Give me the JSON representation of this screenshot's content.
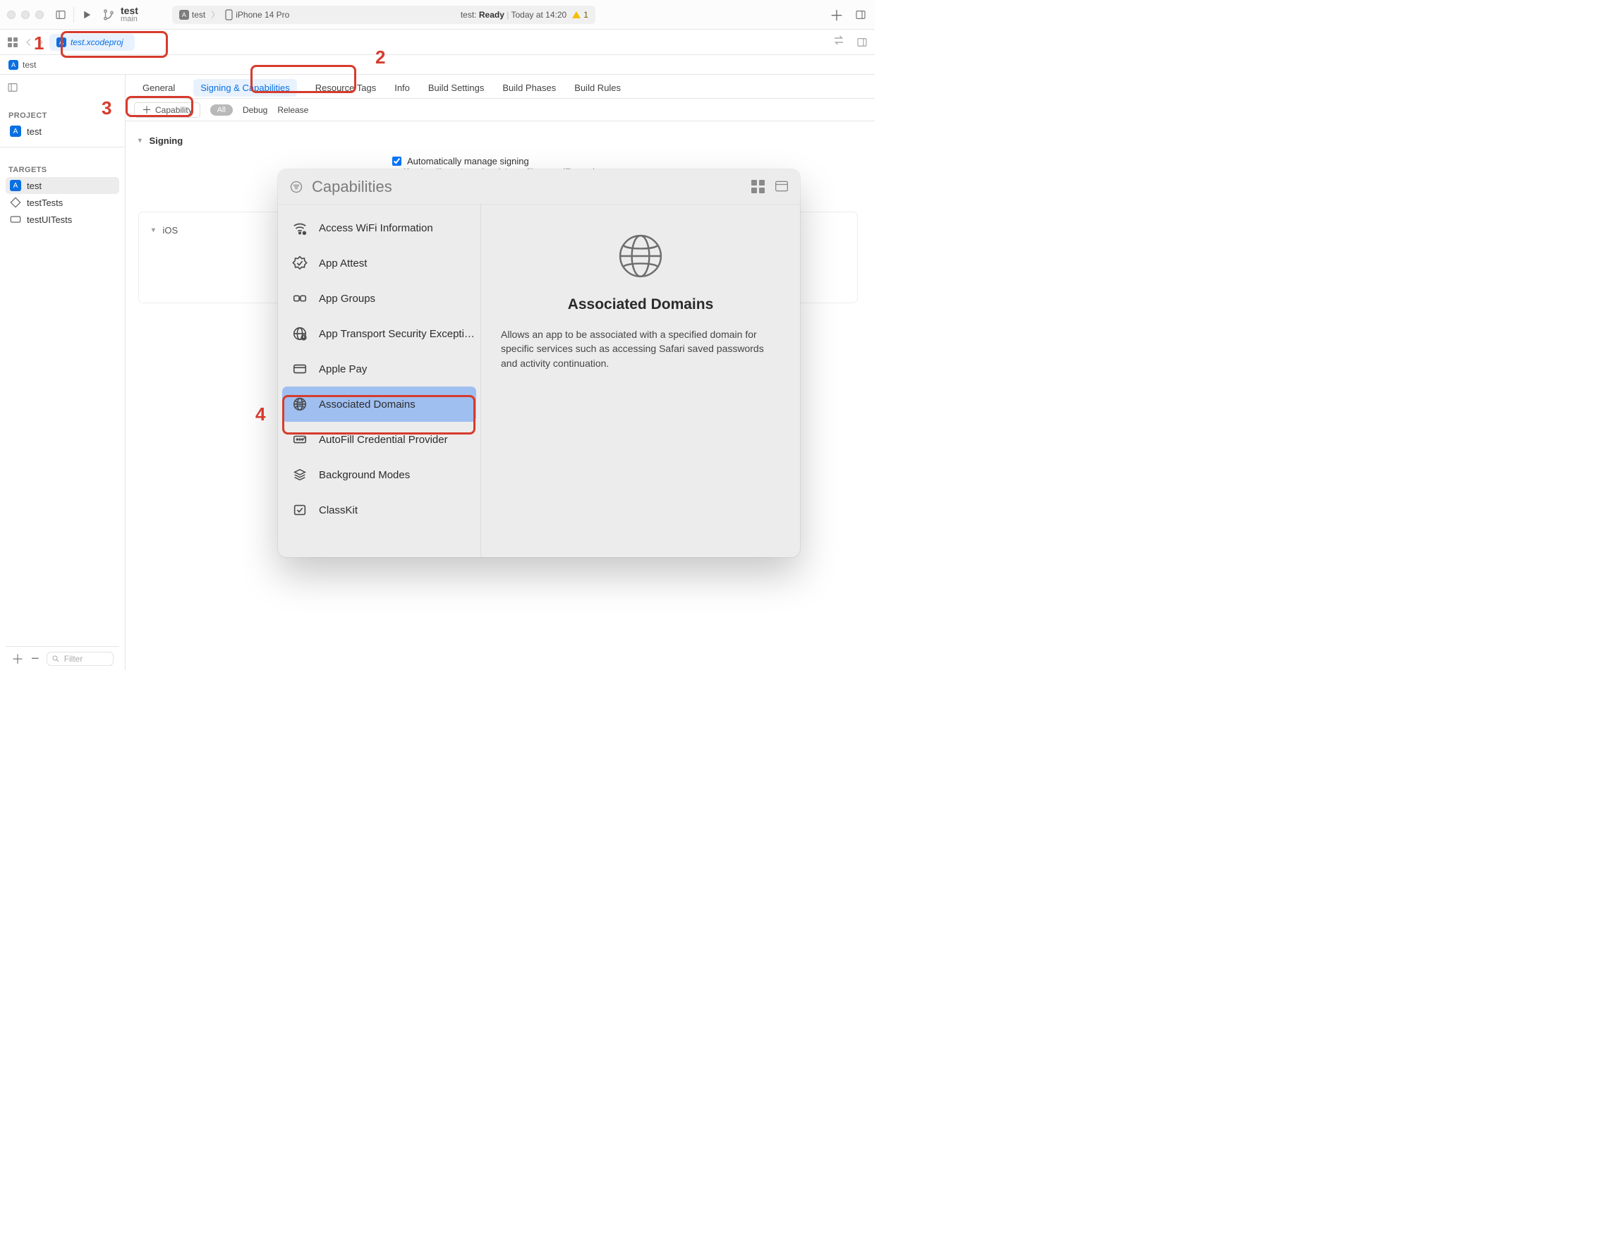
{
  "toolbar": {
    "scheme_name": "test",
    "scheme_branch": "main",
    "activity": {
      "scheme": "test",
      "device": "iPhone 14 Pro",
      "status_prefix": "test:",
      "status_word": "Ready",
      "status_time": "Today at 14:20",
      "warning_count": "1"
    }
  },
  "tabbar": {
    "open_file": "test.xcodeproj"
  },
  "breadcrumb": {
    "project": "test"
  },
  "sidebar": {
    "project_header": "PROJECT",
    "project_item": "test",
    "targets_header": "TARGETS",
    "targets": [
      {
        "label": "test",
        "icon": "app"
      },
      {
        "label": "testTests",
        "icon": "tests"
      },
      {
        "label": "testUITests",
        "icon": "uitests"
      }
    ],
    "footer": {
      "filter_placeholder": "Filter"
    }
  },
  "editor": {
    "tabs": {
      "general": "General",
      "signing": "Signing & Capabilities",
      "resource": "Resource Tags",
      "info": "Info",
      "buildsettings": "Build Settings",
      "buildphases": "Build Phases",
      "buildrules": "Build Rules"
    },
    "subbar": {
      "capability_btn": "Capability",
      "all": "All",
      "debug": "Debug",
      "release": "Release"
    },
    "section_signing": "Signing",
    "auto_manage": "Automatically manage signing",
    "auto_manage_sub": "Xcode will create and update profiles, app IDs, and",
    "ios_section": "iOS"
  },
  "popover": {
    "title": "Capabilities",
    "items": [
      "Access WiFi Information",
      "App Attest",
      "App Groups",
      "App Transport Security Excepti…",
      "Apple Pay",
      "Associated Domains",
      "AutoFill Credential Provider",
      "Background Modes",
      "ClassKit"
    ],
    "selected_index": 5,
    "detail": {
      "title": "Associated Domains",
      "body": "Allows an app to be associated with a specified domain for specific services such as accessing Safari saved passwords and activity continuation."
    }
  },
  "annotations": {
    "n1": "1",
    "n2": "2",
    "n3": "3",
    "n4": "4"
  }
}
